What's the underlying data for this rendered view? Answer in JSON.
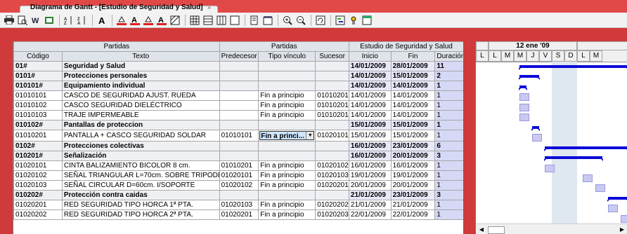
{
  "window": {
    "tab_title": "Diagrama de Gantt - [Estudio de Seguridad y Salud]",
    "close_glyph": "×"
  },
  "toolbar": {
    "icons": [
      "printer-icon",
      "print-preview-icon",
      "export-icon",
      "import-icon",
      "sort-asc-icon",
      "sort-desc-icon",
      "font-icon",
      "fill-color-icon",
      "font-color-icon",
      "highlight-icon",
      "text-color-icon",
      "pattern-icon",
      "grid-icon",
      "columns-icon",
      "rows-icon",
      "border-icon",
      "copy-icon",
      "properties-icon",
      "zoom-in-icon",
      "zoom-out-icon",
      "refresh-icon",
      "chart-icon",
      "settings-icon",
      "calendar-icon"
    ]
  },
  "table": {
    "group_headers": {
      "partidas_left": "Partidas",
      "partidas_right": "Partidas",
      "estudio": "Estudio de Seguridad y Salud"
    },
    "columns": [
      "Código",
      "Texto",
      "Predecesor",
      "Tipo vínculo",
      "Sucesor",
      "Inicio",
      "Fin",
      "Duración"
    ],
    "rows": [
      {
        "codigo": "01#",
        "texto": "Seguridad y Salud",
        "pred": "",
        "tipo": "",
        "suc": "",
        "inicio": "14/01/2009",
        "fin": "28/01/2009",
        "dur": "11",
        "summary": true
      },
      {
        "codigo": "0101#",
        "texto": "Protecciones personales",
        "pred": "",
        "tipo": "",
        "suc": "",
        "inicio": "14/01/2009",
        "fin": "15/01/2009",
        "dur": "2",
        "summary": true
      },
      {
        "codigo": "010101#",
        "texto": "Equipamiento individual",
        "pred": "",
        "tipo": "",
        "suc": "",
        "inicio": "14/01/2009",
        "fin": "14/01/2009",
        "dur": "1",
        "summary": true
      },
      {
        "codigo": "01010101",
        "texto": "CASCO DE SEGURIDAD AJUST. RUEDA",
        "pred": "",
        "tipo": "Fin a principio",
        "suc": "01010201",
        "inicio": "14/01/2009",
        "fin": "14/01/2009",
        "dur": "1",
        "summary": false
      },
      {
        "codigo": "01010102",
        "texto": "CASCO SEGURIDAD DIELÉCTRICO",
        "pred": "",
        "tipo": "Fin a principio",
        "suc": "01010201",
        "inicio": "14/01/2009",
        "fin": "14/01/2009",
        "dur": "1",
        "summary": false
      },
      {
        "codigo": "01010103",
        "texto": "TRAJE IMPERMEABLE",
        "pred": "",
        "tipo": "Fin a principio",
        "suc": "01010201",
        "inicio": "14/01/2009",
        "fin": "14/01/2009",
        "dur": "1",
        "summary": false
      },
      {
        "codigo": "010102#",
        "texto": "Pantallas de proteccion",
        "pred": "",
        "tipo": "",
        "suc": "",
        "inicio": "15/01/2009",
        "fin": "15/01/2009",
        "dur": "1",
        "summary": true
      },
      {
        "codigo": "01010201",
        "texto": "PANTALLA  + CASCO SEGURIDAD SOLDAR",
        "pred": "01010101",
        "tipo": "Fin a princi...",
        "suc": "01020101",
        "inicio": "15/01/2009",
        "fin": "15/01/2009",
        "dur": "1",
        "summary": false,
        "editing": true
      },
      {
        "codigo": "0102#",
        "texto": "Protecciones colectivas",
        "pred": "",
        "tipo": "",
        "suc": "",
        "inicio": "16/01/2009",
        "fin": "23/01/2009",
        "dur": "6",
        "summary": true
      },
      {
        "codigo": "010201#",
        "texto": "Señalización",
        "pred": "",
        "tipo": "",
        "suc": "",
        "inicio": "16/01/2009",
        "fin": "20/01/2009",
        "dur": "3",
        "summary": true
      },
      {
        "codigo": "01020101",
        "texto": "CINTA BALIZAMIENTO BICOLOR 8 cm.",
        "pred": "01010201",
        "tipo": "Fin a principio",
        "suc": "01020102",
        "inicio": "16/01/2009",
        "fin": "16/01/2009",
        "dur": "1",
        "summary": false
      },
      {
        "codigo": "01020102",
        "texto": "SEÑAL TRIANGULAR L=70cm. SOBRE TRIPODE",
        "pred": "01020101",
        "tipo": "Fin a principio",
        "suc": "01020103",
        "inicio": "19/01/2009",
        "fin": "19/01/2009",
        "dur": "1",
        "summary": false
      },
      {
        "codigo": "01020103",
        "texto": "SEÑAL CIRCULAR D=60cm. I/SOPORTE",
        "pred": "01020102",
        "tipo": "Fin a principio",
        "suc": "01020201",
        "inicio": "20/01/2009",
        "fin": "20/01/2009",
        "dur": "1",
        "summary": false
      },
      {
        "codigo": "010202#",
        "texto": "Protección contra caidas",
        "pred": "",
        "tipo": "",
        "suc": "",
        "inicio": "21/01/2009",
        "fin": "23/01/2009",
        "dur": "3",
        "summary": true
      },
      {
        "codigo": "01020201",
        "texto": "RED SEGURIDAD TIPO HORCA 1ª PTA.",
        "pred": "01020103",
        "tipo": "Fin a principio",
        "suc": "01020202",
        "inicio": "21/01/2009",
        "fin": "21/01/2009",
        "dur": "1",
        "summary": false
      },
      {
        "codigo": "01020202",
        "texto": "RED SEGURIDAD TIPO HORCA 2ª PTA.",
        "pred": "01020201",
        "tipo": "Fin a principio",
        "suc": "01020203",
        "inicio": "22/01/2009",
        "fin": "22/01/2009",
        "dur": "1",
        "summary": false
      }
    ]
  },
  "gantt": {
    "week_label": "12 ene '09",
    "days": [
      "L",
      "M",
      "M",
      "J",
      "V",
      "S",
      "D",
      "L",
      "M"
    ]
  }
}
